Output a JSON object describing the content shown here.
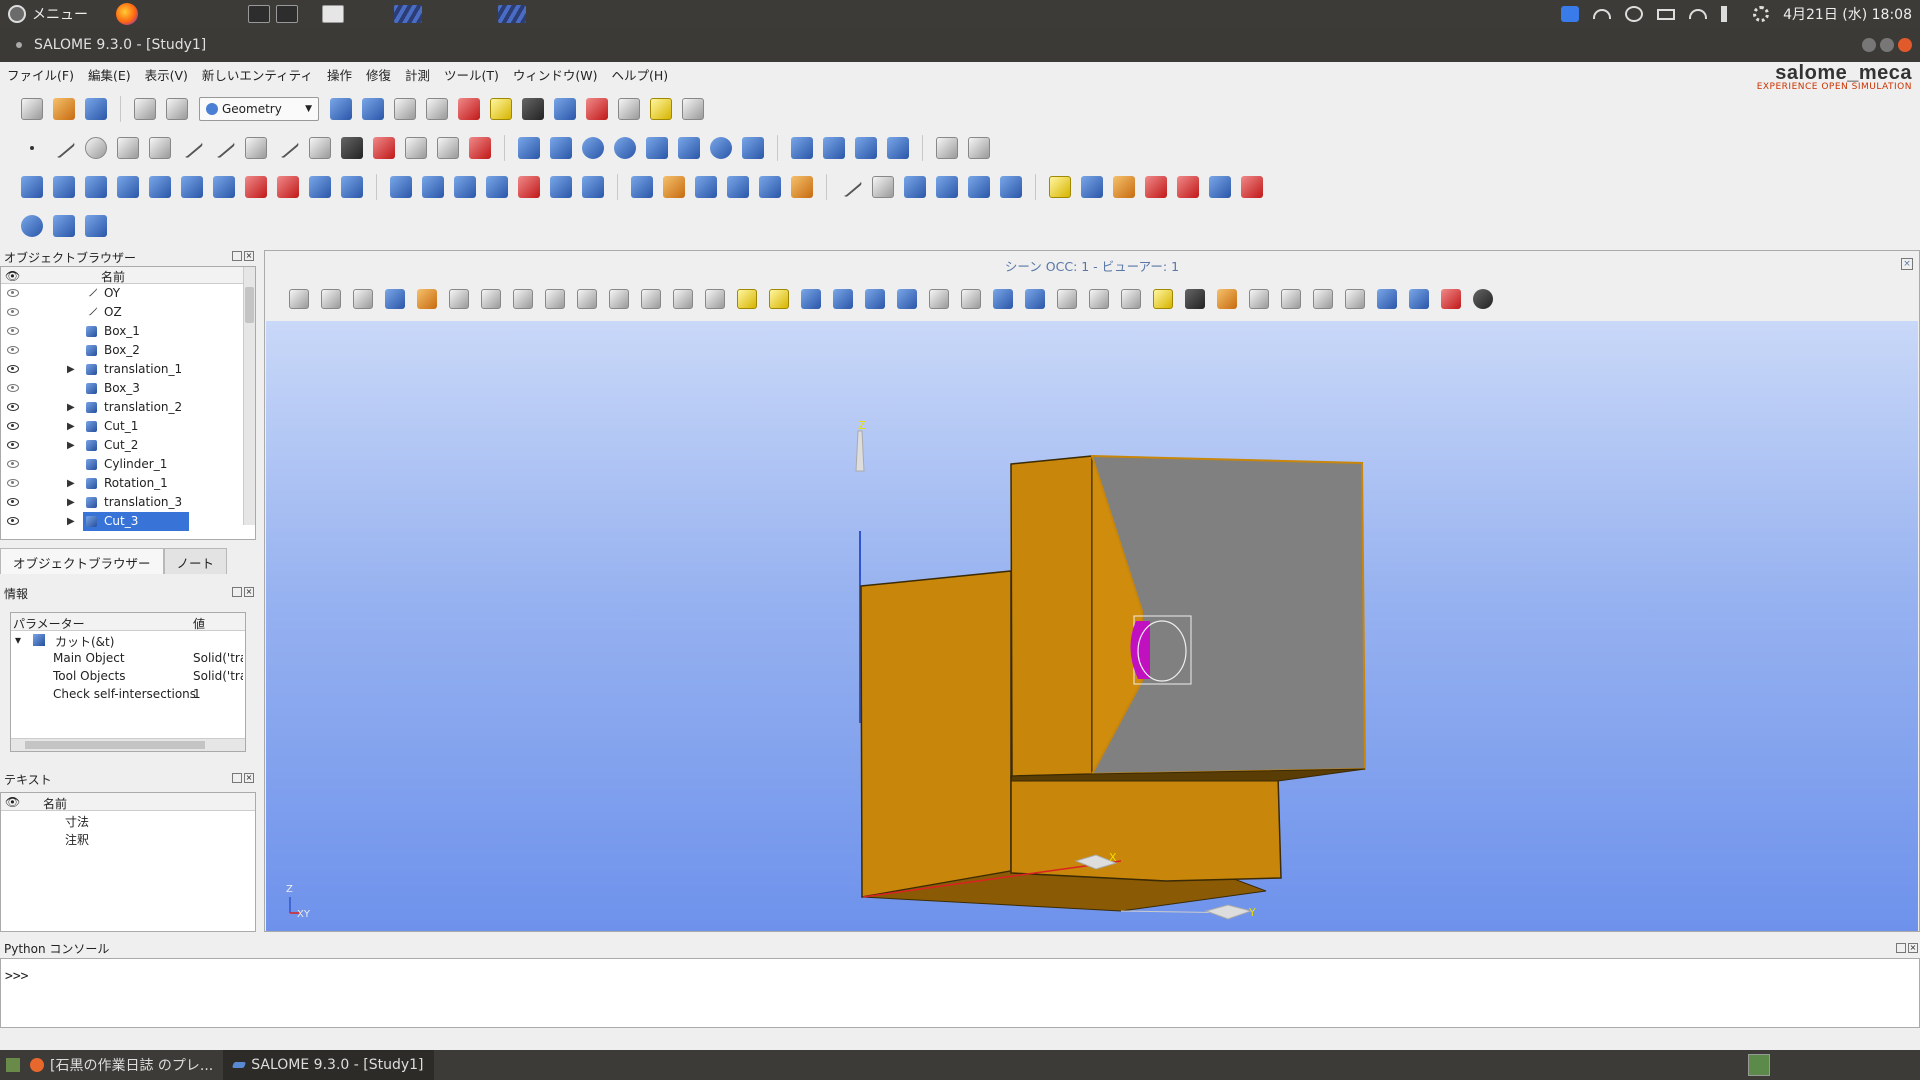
{
  "top_panel": {
    "menu_label": "メニュー",
    "clock": "4月21日 (水) 18:08"
  },
  "window": {
    "title": "SALOME 9.3.0 - [Study1]"
  },
  "menubar": {
    "items": [
      "ファイル(F)",
      "編集(E)",
      "表示(V)",
      "新しいエンティティ",
      "操作",
      "修復",
      "計測",
      "ツール(T)",
      "ウィンドウ(W)",
      "ヘルプ(H)"
    ]
  },
  "brand": {
    "main": "salome_meca",
    "sub": "EXPERIENCE OPEN SIMULATION"
  },
  "toolbar": {
    "module_select": "Geometry"
  },
  "object_browser": {
    "title": "オブジェクトブラウザー",
    "name_header": "名前",
    "items": [
      {
        "label": "OY",
        "visible": false,
        "expandable": false,
        "icon": "line-icon"
      },
      {
        "label": "OZ",
        "visible": false,
        "expandable": false,
        "icon": "line-icon"
      },
      {
        "label": "Box_1",
        "visible": false,
        "expandable": false,
        "icon": "solid-icon"
      },
      {
        "label": "Box_2",
        "visible": false,
        "expandable": false,
        "icon": "solid-icon"
      },
      {
        "label": "translation_1",
        "visible": true,
        "expandable": true,
        "icon": "solid-icon"
      },
      {
        "label": "Box_3",
        "visible": false,
        "expandable": false,
        "icon": "solid-icon"
      },
      {
        "label": "translation_2",
        "visible": true,
        "expandable": true,
        "icon": "solid-icon"
      },
      {
        "label": "Cut_1",
        "visible": true,
        "expandable": true,
        "icon": "solid-icon"
      },
      {
        "label": "Cut_2",
        "visible": true,
        "expandable": true,
        "icon": "solid-icon"
      },
      {
        "label": "Cylinder_1",
        "visible": false,
        "expandable": false,
        "icon": "solid-icon"
      },
      {
        "label": "Rotation_1",
        "visible": false,
        "expandable": true,
        "icon": "solid-icon"
      },
      {
        "label": "translation_3",
        "visible": true,
        "expandable": true,
        "icon": "solid-icon"
      },
      {
        "label": "Cut_3",
        "visible": true,
        "expandable": true,
        "icon": "solid-icon",
        "selected": true
      }
    ]
  },
  "tabs": {
    "browser": "オブジェクトブラウザー",
    "notes": "ノート"
  },
  "info_panel": {
    "title": "情報",
    "col_param": "パラメーター",
    "col_value": "値",
    "root": "カット(&t)",
    "rows": [
      {
        "name": "Main Object",
        "value": "Solid('tra"
      },
      {
        "name": "Tool Objects",
        "value": "Solid('tra"
      },
      {
        "name": "Check self-intersections",
        "value": "1"
      }
    ]
  },
  "text_panel": {
    "title": "テキスト",
    "name_header": "名前",
    "items": [
      "寸法",
      "注釈"
    ]
  },
  "viewer": {
    "title": "シーン OCC: 1 - ビューアー: 1",
    "axis_labels": {
      "z_top": "Z",
      "x": "X",
      "y": "Y",
      "corner_z": "Z",
      "corner_xy": "XY"
    }
  },
  "python": {
    "title": "Python コンソール",
    "prompt": ">>>"
  },
  "taskbar": {
    "task1": "[石黒の作業日誌 のプレ...",
    "task2": "SALOME 9.3.0 - [Study1]"
  },
  "colors": {
    "selection": "#3874d8",
    "model_orange": "#c8860a",
    "model_gray": "#808080",
    "model_magenta": "#c010c0"
  }
}
